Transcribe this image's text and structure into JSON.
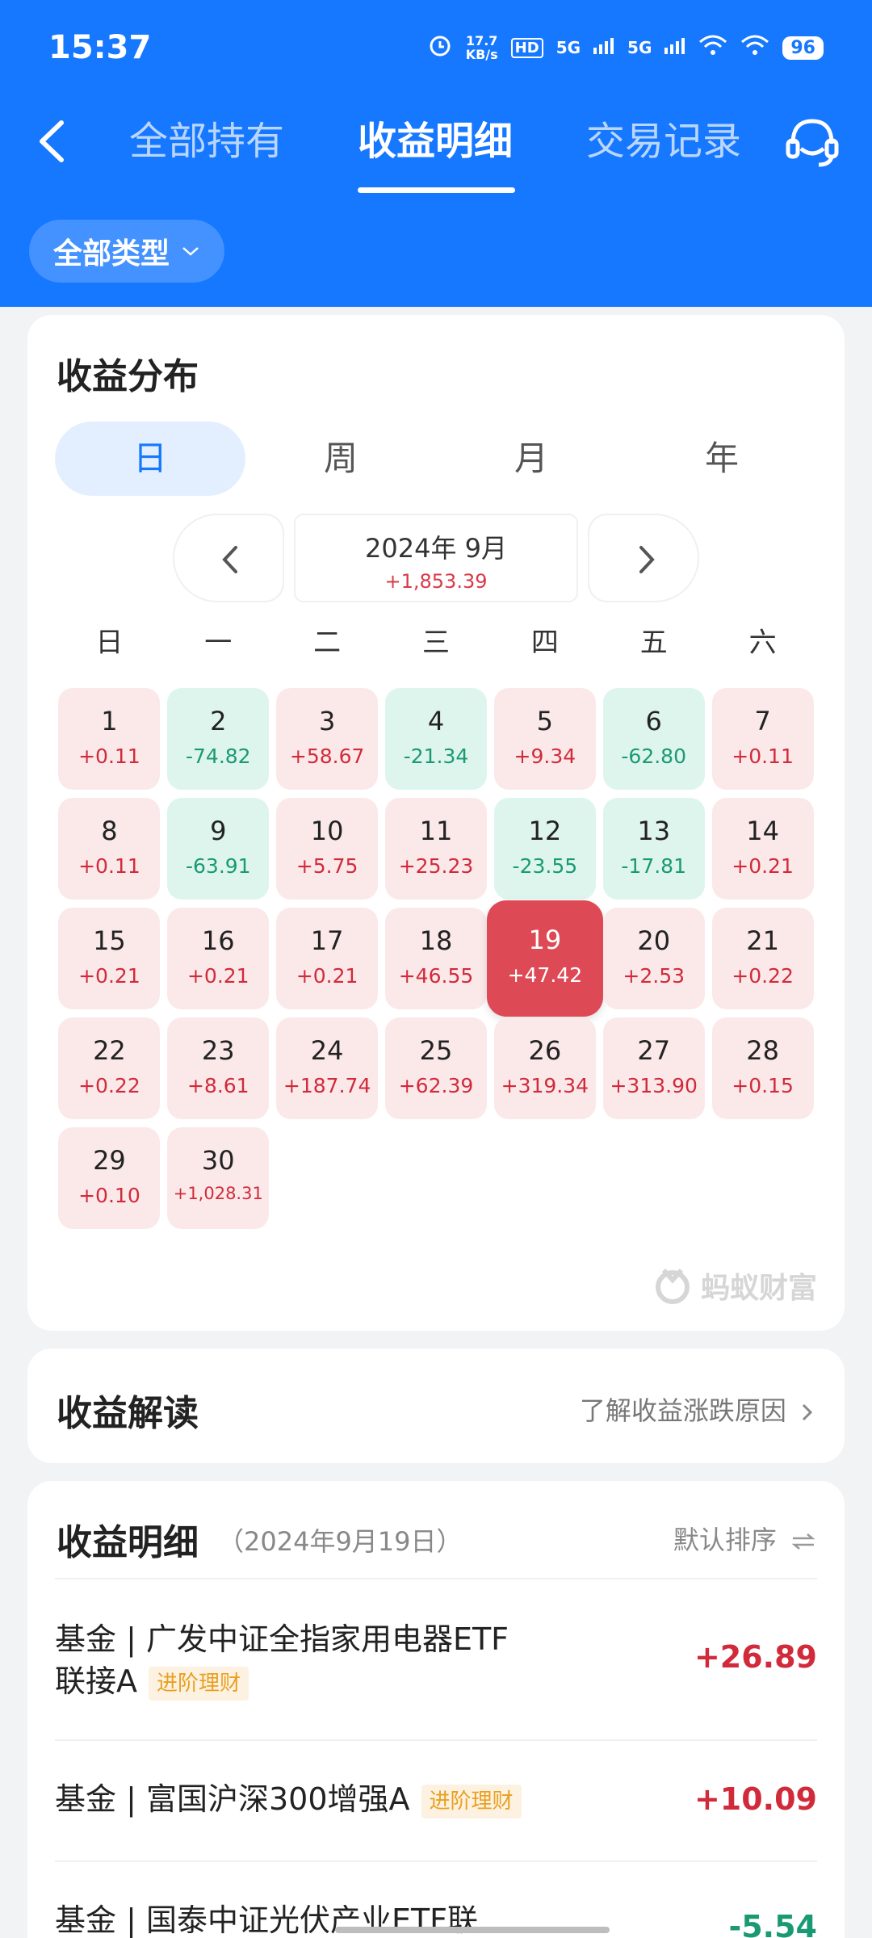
{
  "status_bar": {
    "time": "15:37",
    "net_speed_value": "17.7",
    "net_speed_unit": "KB/s",
    "hd_badge": "HD",
    "sig1": "5G",
    "sig2": "5G",
    "battery": "96"
  },
  "nav": {
    "tabs": [
      {
        "label": "全部持有",
        "active": false
      },
      {
        "label": "收益明细",
        "active": true
      },
      {
        "label": "交易记录",
        "active": false
      }
    ]
  },
  "filter": {
    "label": "全部类型"
  },
  "distribution": {
    "title": "收益分布",
    "segments": [
      {
        "label": "日",
        "active": true
      },
      {
        "label": "周",
        "active": false
      },
      {
        "label": "月",
        "active": false
      },
      {
        "label": "年",
        "active": false
      }
    ],
    "month": "2024年 9月",
    "month_total": "+1,853.39",
    "weekdays": [
      "日",
      "一",
      "二",
      "三",
      "四",
      "五",
      "六"
    ],
    "days": [
      {
        "day": "1",
        "value": "+0.11",
        "trend": "up"
      },
      {
        "day": "2",
        "value": "-74.82",
        "trend": "down"
      },
      {
        "day": "3",
        "value": "+58.67",
        "trend": "up"
      },
      {
        "day": "4",
        "value": "-21.34",
        "trend": "down"
      },
      {
        "day": "5",
        "value": "+9.34",
        "trend": "up"
      },
      {
        "day": "6",
        "value": "-62.80",
        "trend": "down"
      },
      {
        "day": "7",
        "value": "+0.11",
        "trend": "up"
      },
      {
        "day": "8",
        "value": "+0.11",
        "trend": "up"
      },
      {
        "day": "9",
        "value": "-63.91",
        "trend": "down"
      },
      {
        "day": "10",
        "value": "+5.75",
        "trend": "up"
      },
      {
        "day": "11",
        "value": "+25.23",
        "trend": "up"
      },
      {
        "day": "12",
        "value": "-23.55",
        "trend": "down"
      },
      {
        "day": "13",
        "value": "-17.81",
        "trend": "down"
      },
      {
        "day": "14",
        "value": "+0.21",
        "trend": "up"
      },
      {
        "day": "15",
        "value": "+0.21",
        "trend": "up"
      },
      {
        "day": "16",
        "value": "+0.21",
        "trend": "up"
      },
      {
        "day": "17",
        "value": "+0.21",
        "trend": "up"
      },
      {
        "day": "18",
        "value": "+46.55",
        "trend": "up"
      },
      {
        "day": "19",
        "value": "+47.42",
        "trend": "up",
        "selected": true
      },
      {
        "day": "20",
        "value": "+2.53",
        "trend": "up"
      },
      {
        "day": "21",
        "value": "+0.22",
        "trend": "up"
      },
      {
        "day": "22",
        "value": "+0.22",
        "trend": "up"
      },
      {
        "day": "23",
        "value": "+8.61",
        "trend": "up"
      },
      {
        "day": "24",
        "value": "+187.74",
        "trend": "up"
      },
      {
        "day": "25",
        "value": "+62.39",
        "trend": "up"
      },
      {
        "day": "26",
        "value": "+319.34",
        "trend": "up"
      },
      {
        "day": "27",
        "value": "+313.90",
        "trend": "up"
      },
      {
        "day": "28",
        "value": "+0.15",
        "trend": "up"
      },
      {
        "day": "29",
        "value": "+0.10",
        "trend": "up"
      },
      {
        "day": "30",
        "value": "+1,028.31",
        "trend": "up"
      }
    ],
    "watermark": "蚂蚁财富"
  },
  "interpretation": {
    "title": "收益解读",
    "link": "了解收益涨跌原因"
  },
  "details": {
    "title": "收益明细",
    "date": "（2024年9月19日）",
    "sort": "默认排序",
    "items": [
      {
        "name": "基金 | 广发中证全指家用电器ETF联接A",
        "tag": "进阶理财",
        "amount": "+26.89"
      },
      {
        "name": "基金 | 富国沪深300增强A",
        "tag": "进阶理财",
        "amount": "+10.09"
      },
      {
        "name": "基金 | 国泰中证光伏产业ETF联",
        "tag": "",
        "amount": "-5.54"
      }
    ]
  },
  "colors": {
    "brand_blue": "#1677ff",
    "gain_red": "#d12b3b",
    "loss_green": "#1a9a72",
    "selected_day": "#dd4a56"
  }
}
